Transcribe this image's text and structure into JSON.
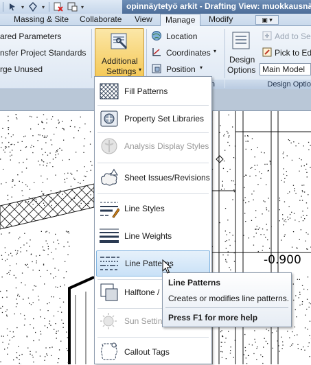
{
  "window": {
    "title": "opinnäytetyö arkit - Drafting View: muokkausnä..."
  },
  "qat": {
    "icons": [
      "arrow-icon",
      "pin-icon",
      "save-icon",
      "delete-icon",
      "sync-icon"
    ]
  },
  "tabs": [
    {
      "label": "Massing & Site",
      "active": false
    },
    {
      "label": "Collaborate",
      "active": false
    },
    {
      "label": "View",
      "active": false
    },
    {
      "label": "Manage",
      "active": true
    },
    {
      "label": "Modify",
      "active": false
    }
  ],
  "ribbon": {
    "settings_items": [
      "ared Parameters",
      "nsfer Project Standards",
      "rge Unused"
    ],
    "additional_settings": {
      "line1": "Additional",
      "line2": "Settings"
    },
    "project_location": {
      "location": "Location",
      "coordinates": "Coordinates",
      "position": "Position"
    },
    "design_options": {
      "line1": "Design",
      "line2": "Options",
      "add_to_set": "Add to Se",
      "pick_to_edit": "Pick to Ed",
      "main_model": "Main Model",
      "panel_label": "Design Optio"
    },
    "panel_bar_left": "n"
  },
  "menu": {
    "items": [
      {
        "label": "Fill Patterns",
        "icon": "fill-patterns-icon",
        "enabled": true
      },
      {
        "label": "Property Set Libraries",
        "icon": "property-set-icon",
        "enabled": true
      },
      {
        "label": "Analysis Display Styles",
        "icon": "analysis-display-icon",
        "enabled": false
      },
      {
        "label": "Sheet Issues/Revisions",
        "icon": "sheet-issues-icon",
        "enabled": true
      },
      {
        "label": "Line Styles",
        "icon": "line-styles-icon",
        "enabled": true
      },
      {
        "label": "Line Weights",
        "icon": "line-weights-icon",
        "enabled": true
      },
      {
        "label": "Line Patterns",
        "icon": "line-patterns-icon",
        "enabled": true,
        "hover": true
      },
      {
        "label": "Halftone / ",
        "icon": "halftone-icon",
        "enabled": true
      },
      {
        "label": "Sun Setting",
        "icon": "sun-settings-icon",
        "enabled": false
      },
      {
        "label": "Callout Tags",
        "icon": "callout-tags-icon",
        "enabled": true
      }
    ]
  },
  "tooltip": {
    "title": "Line Patterns",
    "description": "Creates or modifies line patterns.",
    "help": "Press F1 for more help"
  },
  "drawing": {
    "elevation_label": "-0.900"
  },
  "colors": {
    "accent": "#f5c957",
    "hover": "#c9e1f7",
    "titlebar": "#4d6d98"
  }
}
